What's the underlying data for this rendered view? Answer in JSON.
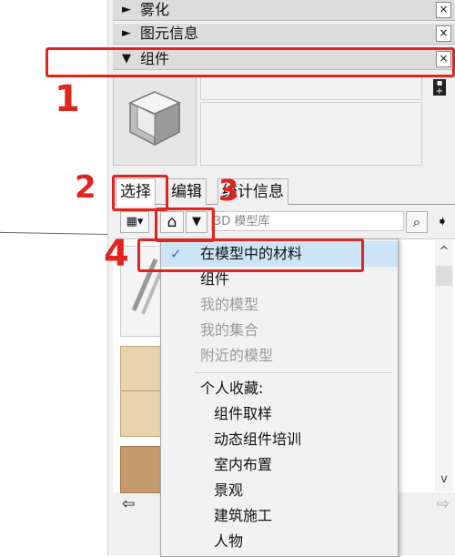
{
  "trays": [
    {
      "label": "雾化",
      "arrow": "►",
      "close": "×"
    },
    {
      "label": "图元信息",
      "arrow": "►",
      "close": "×"
    },
    {
      "label": "组件",
      "arrow": "▼",
      "close": "×"
    }
  ],
  "tabs": [
    {
      "label": "选择"
    },
    {
      "label": "编辑"
    },
    {
      "label": "统计信息"
    }
  ],
  "toolbar": {
    "view_options_glyph": "▦▾",
    "home_glyph": "⌂",
    "dropdown_glyph": "▼",
    "search_placeholder": "3D 模型库",
    "search_glyph": "⌕",
    "details_glyph": "➧"
  },
  "menu": {
    "check": "✓",
    "items": [
      {
        "label": "在模型中的材料",
        "selected": true
      },
      {
        "label": "组件"
      },
      {
        "label": "我的模型",
        "disabled": true
      },
      {
        "label": "我的集合",
        "disabled": true
      },
      {
        "label": "附近的模型",
        "disabled": true
      }
    ],
    "favorites_header": "个人收藏:",
    "favorites": [
      "组件取样",
      "动态组件培训",
      "室内布置",
      "景观",
      "建筑施工",
      "人物"
    ]
  },
  "nav": {
    "back_glyph": "⇦",
    "forward_glyph": "⇨"
  },
  "scroll": {
    "up": "^",
    "down": "v"
  },
  "annotations": {
    "n1": "1",
    "n2": "2",
    "n3": "3",
    "n4": "4"
  },
  "colors": {
    "annotation": "#e0241f",
    "selected_bg": "#cde4f7"
  }
}
